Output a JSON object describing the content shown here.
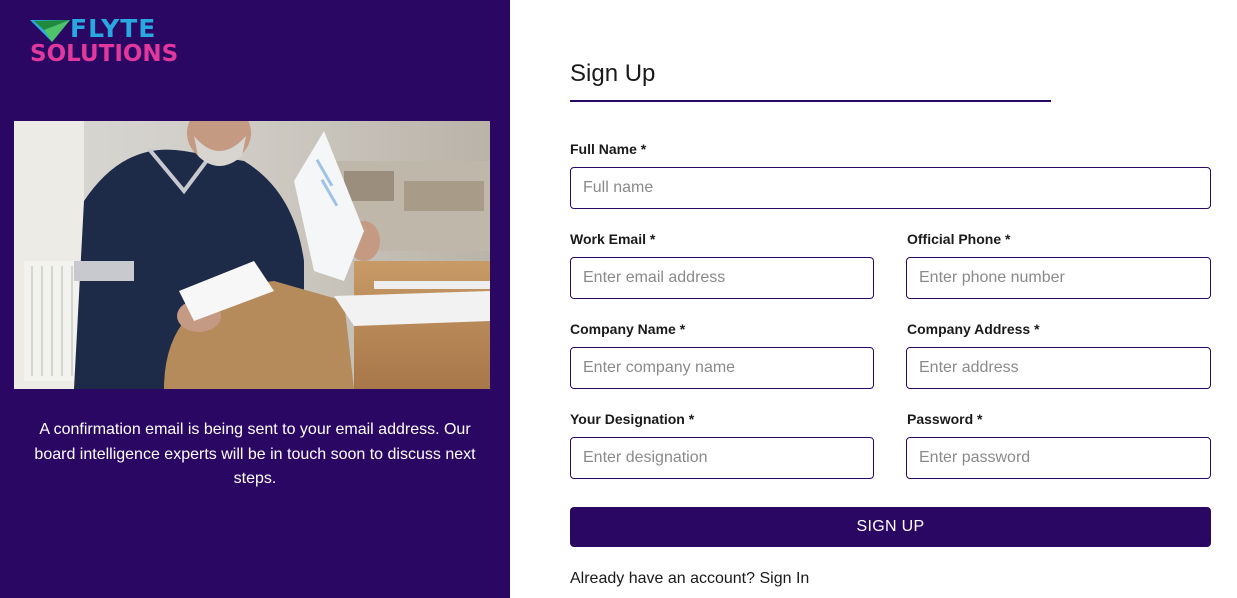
{
  "brand": {
    "logo_line1": "FLYTE",
    "logo_line2": "SOLUTIONS",
    "logo_blue": "#29a8e0",
    "logo_pink": "#e0389c",
    "panel_color": "#2b0764"
  },
  "left_panel": {
    "confirmation_text": "A confirmation email is being sent to your email address. Our board intelligence experts will be in touch soon to discuss next steps."
  },
  "form": {
    "title": "Sign Up",
    "fields": {
      "full_name": {
        "label": "Full Name *",
        "placeholder": "Full name"
      },
      "work_email": {
        "label": "Work Email *",
        "placeholder": "Enter email address"
      },
      "official_phone": {
        "label": "Official Phone *",
        "placeholder": "Enter phone number"
      },
      "company_name": {
        "label": "Company Name *",
        "placeholder": "Enter company name"
      },
      "company_address": {
        "label": "Company Address *",
        "placeholder": "Enter address"
      },
      "designation": {
        "label": "Your Designation *",
        "placeholder": "Enter designation"
      },
      "password": {
        "label": "Password *",
        "placeholder": "Enter password"
      }
    },
    "submit_label": "SIGN UP",
    "signin_prompt": "Already have an account?",
    "signin_link": "Sign In"
  }
}
